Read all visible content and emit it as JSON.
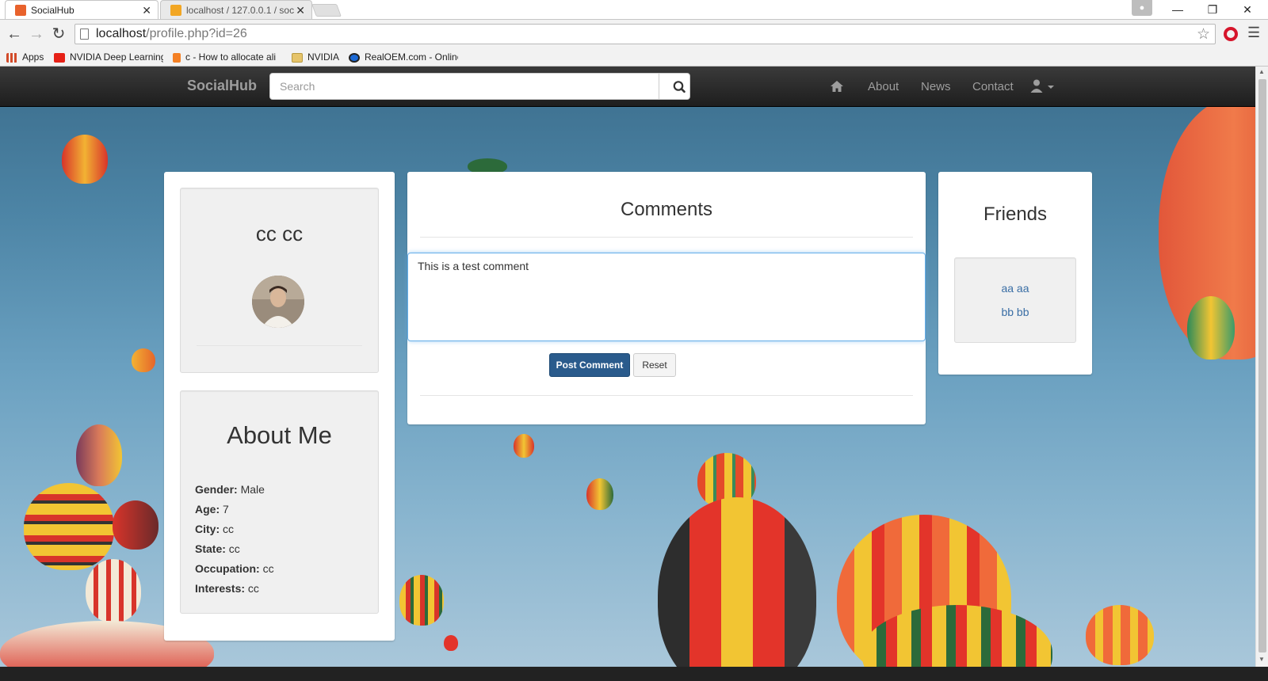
{
  "browser": {
    "tabs": [
      {
        "title": "SocialHub",
        "close": "✕",
        "icon_color": "#e8622c"
      },
      {
        "title": "localhost / 127.0.0.1 / soc",
        "close": "✕",
        "icon_color": "#f2a623"
      }
    ],
    "window_controls": {
      "minimize": "—",
      "restore": "❐",
      "close": "✕"
    },
    "address": {
      "host": "localhost",
      "path": "/profile.php?id=26"
    },
    "bookmarks": [
      {
        "label": "Apps",
        "icon": "apps-grid-icon",
        "color": "#d24b2a"
      },
      {
        "label": "NVIDIA Deep Learning",
        "icon": "youtube-icon",
        "color": "#e62117"
      },
      {
        "label": "c - How to allocate ali",
        "icon": "stackoverflow-icon",
        "color": "#f48024"
      },
      {
        "label": "NVIDIA",
        "icon": "folder-icon",
        "color": "#e6c46a"
      },
      {
        "label": "RealOEM.com - Online",
        "icon": "bmw-icon",
        "color": "#1c69d4"
      }
    ]
  },
  "navbar": {
    "brand": "SocialHub",
    "search_placeholder": "Search",
    "links": [
      "About",
      "News",
      "Contact"
    ]
  },
  "profile": {
    "name": "cc cc"
  },
  "about": {
    "title": "About Me",
    "fields": [
      {
        "label": "Gender:",
        "value": "Male"
      },
      {
        "label": "Age:",
        "value": "7"
      },
      {
        "label": "City:",
        "value": "cc"
      },
      {
        "label": "State:",
        "value": "cc"
      },
      {
        "label": "Occupation:",
        "value": "cc"
      },
      {
        "label": "Interests:",
        "value": "cc"
      }
    ]
  },
  "comments": {
    "title": "Comments",
    "input_value": "This is a test comment",
    "post_label": "Post Comment",
    "reset_label": "Reset"
  },
  "friends": {
    "title": "Friends",
    "list": [
      "aa aa",
      "bb bb"
    ]
  },
  "colors": {
    "navbar": "#222222",
    "primary_button": "#2a5b8c",
    "link": "#3a6ea5",
    "focus_border": "#66afe9"
  }
}
